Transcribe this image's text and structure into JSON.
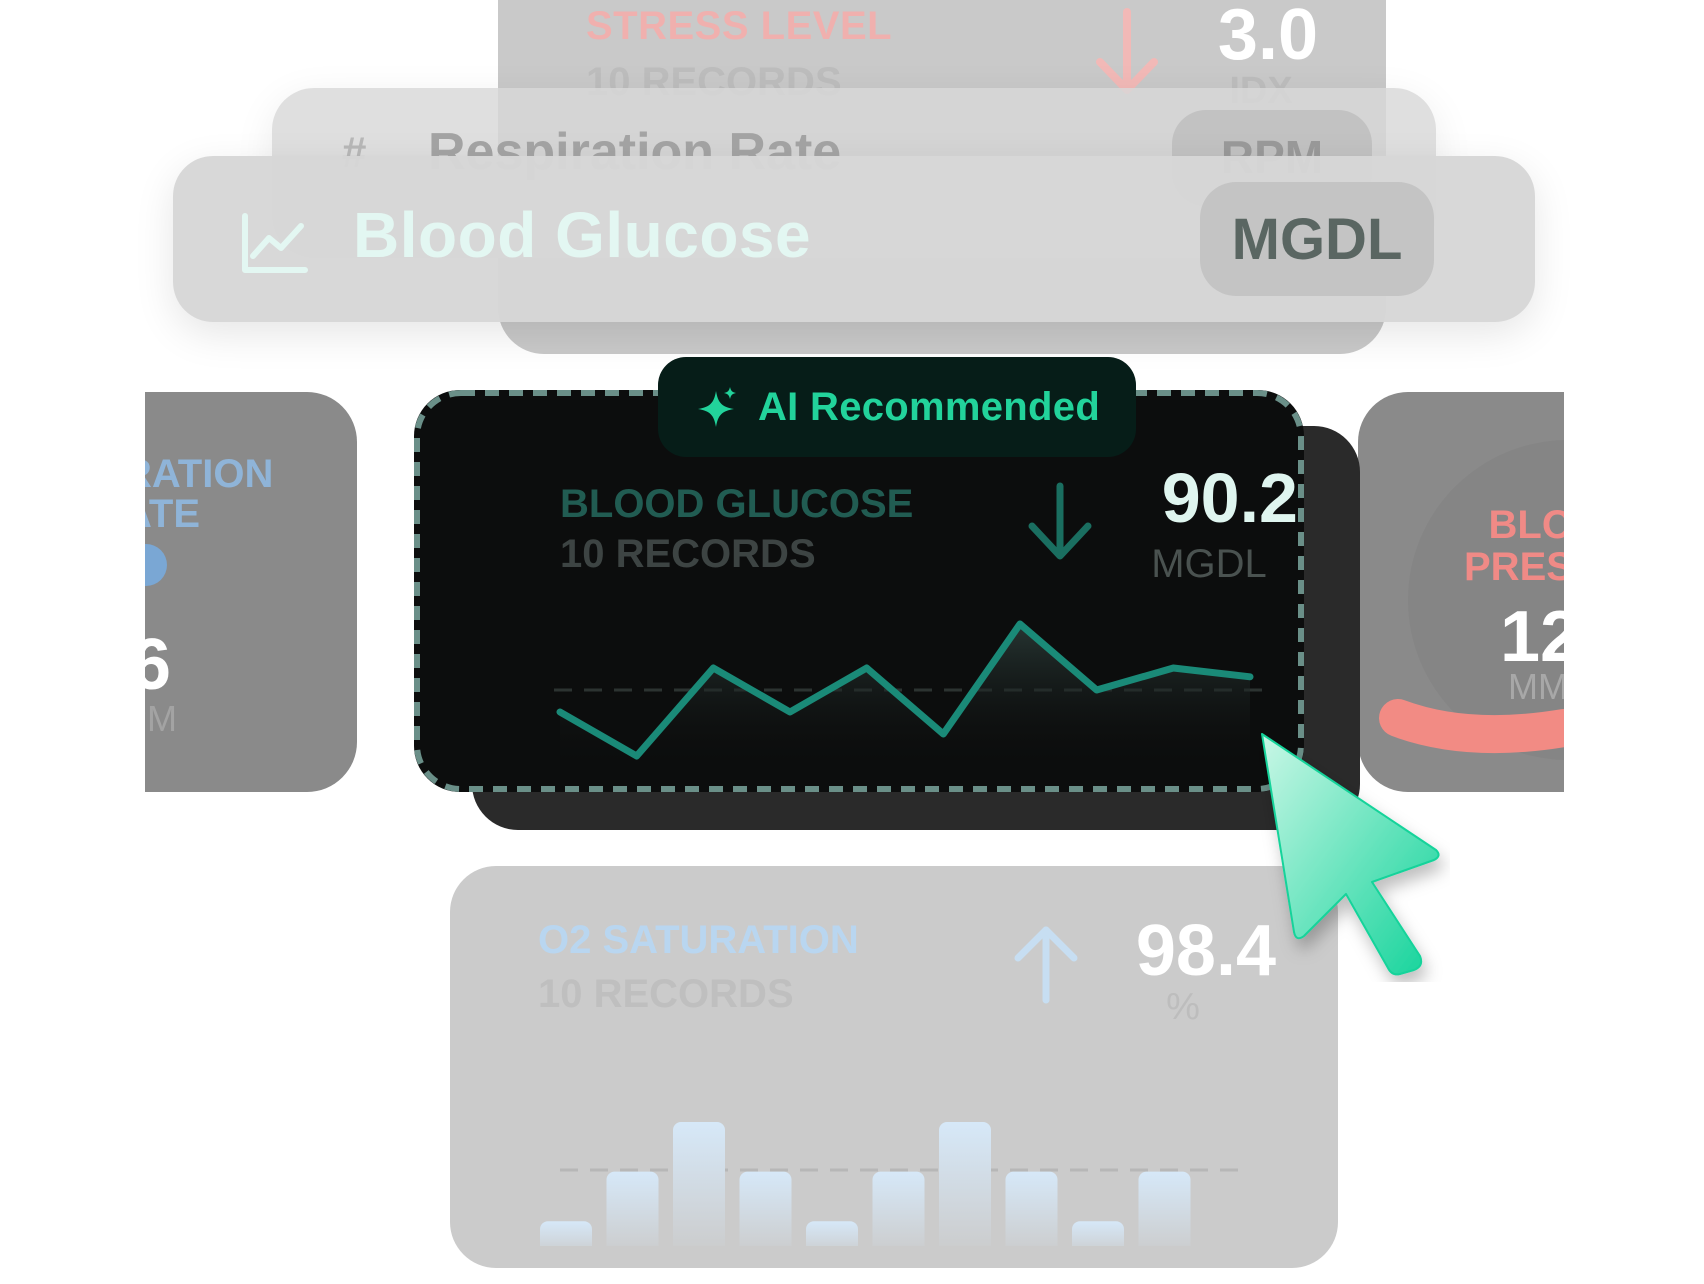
{
  "stress_card": {
    "title": "STRESS LEVEL",
    "records": "10 RECORDS",
    "value": "3.0",
    "unit": "IDX",
    "trend": "down",
    "color": "#f0b0ae"
  },
  "respiration_header": {
    "icon": "hash-icon",
    "icon_glyph": "#",
    "title": "Respiration Rate",
    "badge": "RPM"
  },
  "glucose_header": {
    "icon": "line-chart-icon",
    "title": "Blood Glucose",
    "badge": "MGDL"
  },
  "left_card": {
    "title": "RATION\nATE",
    "value": "6",
    "unit": "PM",
    "color": "#8fb4d8"
  },
  "right_card": {
    "title": "BLO\nPRES",
    "value": "12",
    "unit": "MM",
    "color": "#f08a86"
  },
  "ai_badge": {
    "icon": "sparkle-icon",
    "label": "AI Recommended",
    "color": "#22d39b"
  },
  "main_card": {
    "title": "BLOOD GLUCOSE",
    "records": "10 RECORDS",
    "value": "90.2",
    "unit": "MGDL",
    "trend": "down",
    "accent": "#1a8a78"
  },
  "o2_card": {
    "title": "O2 SATURATION",
    "records": "10 RECORDS",
    "value": "98.4",
    "unit": "%",
    "trend": "up",
    "color": "#b9d6f0"
  },
  "chart_data": [
    {
      "type": "line",
      "series": [
        {
          "values": [
            3,
            1,
            5,
            3,
            5,
            2,
            7,
            4,
            5,
            4.6
          ]
        }
      ],
      "grid": false,
      "baseline": "dashed"
    },
    {
      "type": "bar",
      "series": [
        {
          "values": [
            1,
            3,
            5,
            3,
            1,
            3,
            5,
            3,
            1,
            3
          ]
        }
      ],
      "grid": false,
      "baseline": "dashed"
    }
  ]
}
